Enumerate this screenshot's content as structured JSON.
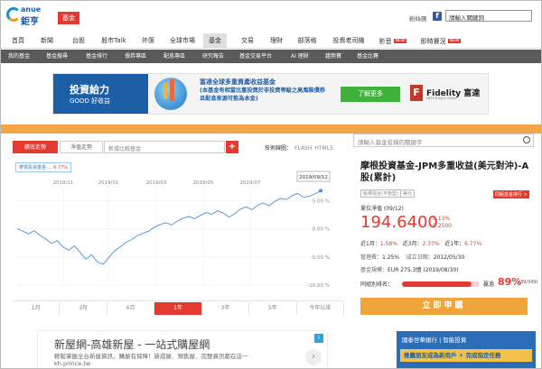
{
  "header": {
    "logo_en": "anue",
    "logo_zh": "鉅亨",
    "section_tag": "基金",
    "fans_label": "粉絲團",
    "search_placeholder": "請輸入關鍵詞"
  },
  "main_nav": [
    {
      "label": "首頁",
      "new": false
    },
    {
      "label": "新聞",
      "new": false
    },
    {
      "label": "台股",
      "new": false
    },
    {
      "label": "股市Talk",
      "new": false
    },
    {
      "label": "外匯",
      "new": false
    },
    {
      "label": "全球市場",
      "new": false
    },
    {
      "label": "基金",
      "new": false,
      "active": true
    },
    {
      "label": "交易",
      "new": false
    },
    {
      "label": "理財",
      "new": false
    },
    {
      "label": "部落格",
      "new": false
    },
    {
      "label": "投資老司機",
      "new": false
    },
    {
      "label": "影音",
      "new": true
    },
    {
      "label": "即時賽況",
      "new": true
    }
  ],
  "new_badge": "NEW",
  "sub_nav": [
    "我的基金",
    "基金搜尋",
    "基金排行",
    "債券專區",
    "配息專區",
    "研究報告",
    "基金交易平台",
    "AI 理財",
    "趨勢寶",
    "基金比賽"
  ],
  "banner": {
    "left_title": "投資給力",
    "left_sub": "GOOD 好收益",
    "headline": "富達全球多重資產收益基金",
    "body": "(本基金有相當比重投資於非投資等級之高風險債券且配息來源可能為本金)",
    "cta": "了解更多",
    "brand": "Fidelity 富達",
    "brand_sub": "INTERNATIONAL"
  },
  "chart_panel": {
    "tab_nav": "績效走勢",
    "tab_premium": "淨值走勢",
    "compare_placeholder": "新增比較基金",
    "plus": "+",
    "tech_label": "技術線圖：",
    "tech_flash": "FLASH",
    "tech_html5": "HTML5",
    "legend_name": "摩根投資基金-...",
    "legend_value": "6.77%",
    "ranges": [
      "1月",
      "3月",
      "6月",
      "1年",
      "3年",
      "5年",
      "今年以來"
    ],
    "active_range": "1年"
  },
  "chart_data": {
    "type": "line",
    "x_ticks": [
      "2018/11",
      "2019/01",
      "2019/03",
      "2019/05",
      "2019/07"
    ],
    "y_ticks": [
      "5.00 %",
      "0.00 %",
      "-5.00 %",
      "-10.00 %"
    ],
    "ylim": [
      -10,
      5
    ],
    "tooltip_label": "2019/09/12",
    "series": [
      {
        "values": [
          0.0,
          -0.4,
          -0.9,
          -0.3,
          -1.2,
          -1.8,
          -2.6,
          -2.1,
          -3.2,
          -3.8,
          -3.0,
          -4.2,
          -5.4,
          -4.6,
          -5.9,
          -6.3,
          -5.1,
          -3.9,
          -3.2,
          -2.4,
          -1.9,
          -1.2,
          -0.8,
          -0.4,
          0.3,
          0.8,
          1.1,
          0.7,
          1.4,
          1.9,
          2.2,
          1.8,
          2.4,
          2.9,
          2.6,
          3.2,
          2.8,
          2.1,
          2.7,
          3.5,
          3.9,
          3.4,
          4.2,
          4.6,
          4.1,
          4.9,
          5.4,
          5.2,
          5.9,
          6.3,
          5.6,
          5.8,
          6.2,
          6.77
        ]
      }
    ]
  },
  "fund": {
    "search_placeholder": "請輸入基金名稱的關鍵字",
    "name": "摩根投資基金-JPM多重收益(美元對沖)-A股(累計)",
    "badge1": "股債混合(平衡型)",
    "badge2": "美元",
    "badge_red": "同組基金排行 >",
    "nav_label": "單位淨值 (09/12)",
    "nav": "194.6400",
    "chg_pct": "0.13%",
    "chg_abs": "0.2500",
    "ret_6m_label": "近1月：",
    "ret_6m": "1.58%",
    "ret_3m_label": "近3月：",
    "ret_3m": "2.37%",
    "ret_1y_label": "近1年：",
    "ret_1y": "6.77%",
    "fee_label": "管理費：",
    "fee": "1.25%",
    "date_label": "成立日期：",
    "date": "2012/05/30",
    "size_label": "基金規模：",
    "size": "EUR 275.3億 (2019/08/30)",
    "rank_label": "同組別排名：",
    "rank_win": "贏過",
    "rank_pct": "89%",
    "rank_count": "(39/349)",
    "rank_fraction": 0.89,
    "buy_label": "立即申購"
  },
  "ads": {
    "left_title": "新屋網-高雄新屋 - 一站式購屋網",
    "left_sub": "輕鬆掌握全台新屋資訊，購屋有保障！新成屋．預售屋．完整資訊都在這一 kh.prince.tw",
    "right_head": "國泰世華銀行 | 智能投資",
    "right_bar": "推薦朋友成為新用戶 + 完成指定任務"
  },
  "colors": {
    "brand_red": "#e43a2f",
    "orange": "#f3a548",
    "line_blue": "#4a90d9"
  }
}
